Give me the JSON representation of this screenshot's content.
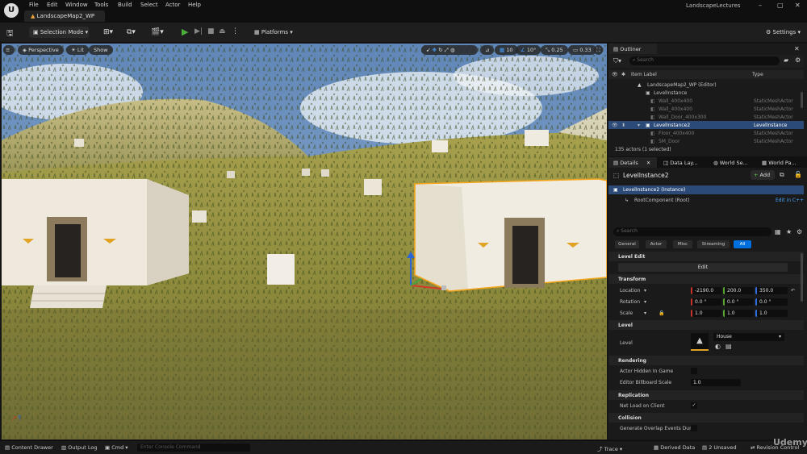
{
  "menu": [
    "File",
    "Edit",
    "Window",
    "Tools",
    "Build",
    "Select",
    "Actor",
    "Help"
  ],
  "window": {
    "tab": "LandscapeMap2_WP",
    "project": "LandscapeLectures"
  },
  "toolbar": {
    "selection_mode": "Selection Mode",
    "platforms": "Platforms",
    "settings": "Settings"
  },
  "viewport": {
    "perspective": "Perspective",
    "lit": "Lit",
    "show": "Show",
    "grid_snap": "10",
    "rot_snap": "10°",
    "scale_snap": "0.25",
    "cam_speed": "0.33"
  },
  "outliner": {
    "title": "Outliner",
    "search_placeholder": "Search",
    "col_label": "Item Label",
    "col_type": "Type",
    "rows": [
      {
        "label": "LandscapeMap2_WP (Editor)",
        "type": ""
      },
      {
        "label": "LevelInstance",
        "type": ""
      },
      {
        "label": "Wall_400x400",
        "type": "StaticMeshActor"
      },
      {
        "label": "Wall_400x400",
        "type": "StaticMeshActor"
      },
      {
        "label": "Wall_Door_400x300",
        "type": "StaticMeshActor"
      },
      {
        "label": "LevelInstance2",
        "type": "LevelInstance"
      },
      {
        "label": "Floor_400x400",
        "type": "StaticMeshActor"
      },
      {
        "label": "SM_Door",
        "type": "StaticMeshActor"
      }
    ],
    "count": "135 actors (1 selected)"
  },
  "details": {
    "tabs": [
      "Details",
      "Data Lay...",
      "World Se...",
      "World Pa..."
    ],
    "actor_name": "LevelInstance2",
    "add_label": "Add",
    "instance": "LevelInstance2 (Instance)",
    "root": "RootComponent (Root)",
    "edit_cpp": "Edit in C++",
    "search_placeholder": "Search",
    "filters": [
      "General",
      "Actor",
      "Misc",
      "Streaming",
      "All"
    ],
    "level_edit": "Level Edit",
    "edit_button": "Edit",
    "transform": "Transform",
    "location": {
      "label": "Location",
      "x": "-2190.0",
      "y": "200.0",
      "z": "350.0"
    },
    "rotation": {
      "label": "Rotation",
      "x": "0.0 °",
      "y": "0.0 °",
      "z": "0.0 °"
    },
    "scale": {
      "label": "Scale",
      "x": "1.0",
      "y": "1.0",
      "z": "1.0"
    },
    "level_section": "Level",
    "level_label": "Level",
    "level_value": "House",
    "rendering": "Rendering",
    "hidden_in_game": "Actor Hidden In Game",
    "billboard_scale": "Editor Billboard Scale",
    "billboard_value": "1.0",
    "replication": "Replication",
    "net_load": "Net Load on Client",
    "collision": "Collision",
    "overlap": "Generate Overlap Events Dur..."
  },
  "status": {
    "content_drawer": "Content Drawer",
    "output_log": "Output Log",
    "cmd": "Cmd",
    "console_placeholder": "Enter Console Command",
    "trace": "Trace",
    "derived": "Derived Data",
    "unsaved": "2 Unsaved",
    "revision": "Revision Control",
    "watermark": "Udemy"
  },
  "colors": {
    "accent": "#0070e0",
    "selection": "#f3a51c",
    "play": "#4caf3c",
    "add": "#2a8a2a"
  }
}
